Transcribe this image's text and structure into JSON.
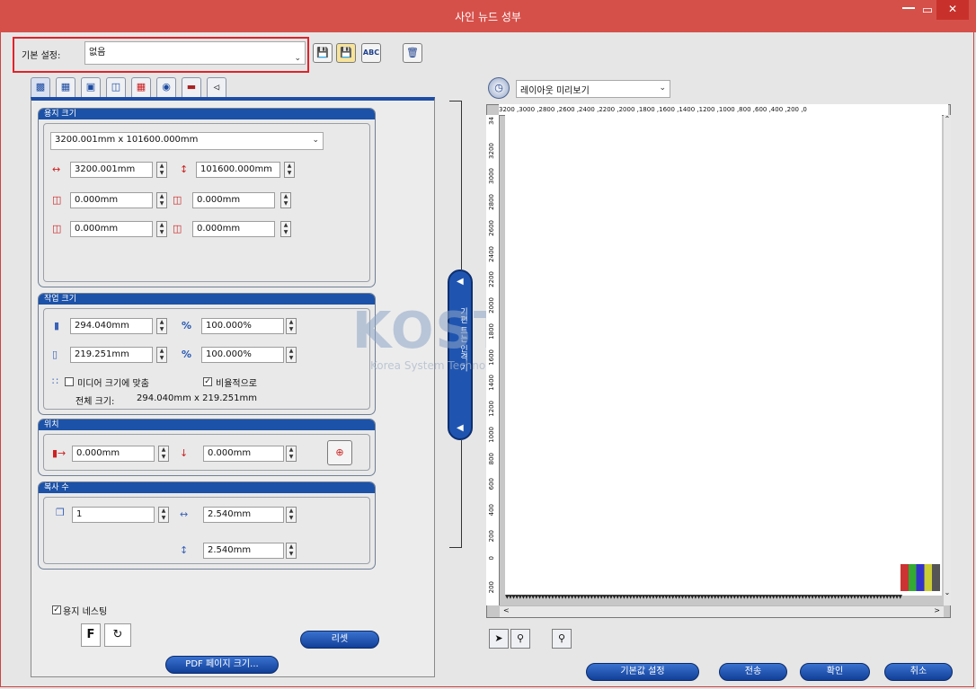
{
  "window": {
    "title": "사인 뉴드 성부"
  },
  "toolbar": {
    "preset_label": "기본 설정:",
    "preset_value": "없음",
    "icons": [
      "save-icon",
      "save-as-icon",
      "rename-icon",
      "delete-icon"
    ]
  },
  "tabs": [
    "media-tab",
    "save-tab",
    "image-tab",
    "layout-tab",
    "tile-tab",
    "mark-tab",
    "color-tab",
    "printer-tab"
  ],
  "media_size": {
    "title": "용지 크기",
    "preset": "3200.001mm x 101600.000mm",
    "width": "3200.001mm",
    "height": "101600.000mm",
    "margin_left": "0.000mm",
    "margin_top": "0.000mm",
    "margin_right": "0.000mm",
    "margin_bottom": "0.000mm"
  },
  "job_size": {
    "title": "작업 크기",
    "width": "294.040mm",
    "height": "219.251mm",
    "width_pct": "100.000%",
    "height_pct": "100.000%",
    "pct_symbol": "%",
    "fit_media_label": "미디어 크기에 맞춤",
    "fit_media_checked": false,
    "proportional_label": "비율적으로",
    "proportional_checked": true,
    "total_label": "전체 크기:",
    "total_value": "294.040mm x 219.251mm"
  },
  "position": {
    "title": "위치",
    "x": "0.000mm",
    "y": "0.000mm"
  },
  "copies": {
    "title": "복사 수",
    "count": "1",
    "h_gap": "2.540mm",
    "v_gap": "2.540mm"
  },
  "nesting": {
    "label": "용지 네스팅",
    "checked": true,
    "f_label": "F"
  },
  "buttons": {
    "reset": "리셋",
    "pdf_page_size": "PDF 페이지 크기...",
    "default_settings": "기본값 설정",
    "send": "전송",
    "ok": "확인",
    "cancel": "취소"
  },
  "splitter": {
    "label": "기편 트는 인격 기"
  },
  "preview": {
    "view_select": "레이아웃 미리보기",
    "ruler_top": "3200 ,3000 ,2800 ,2600 ,2400 ,2200 ,2000 ,1800 ,1600 ,1400 ,1200 ,1000 ,800 ,600 ,400 ,200 ,0",
    "ruler_left": [
      "34",
      "3200",
      "3000",
      "2800",
      "2600",
      "2400",
      "2200",
      "2000",
      "1800",
      "1600",
      "1400",
      "1200",
      "1000",
      "800",
      "600",
      "400",
      "200",
      "0",
      "200"
    ]
  },
  "watermark": {
    "brand": "KOSTECH",
    "sub": "Korea System Technologies. Inc."
  }
}
